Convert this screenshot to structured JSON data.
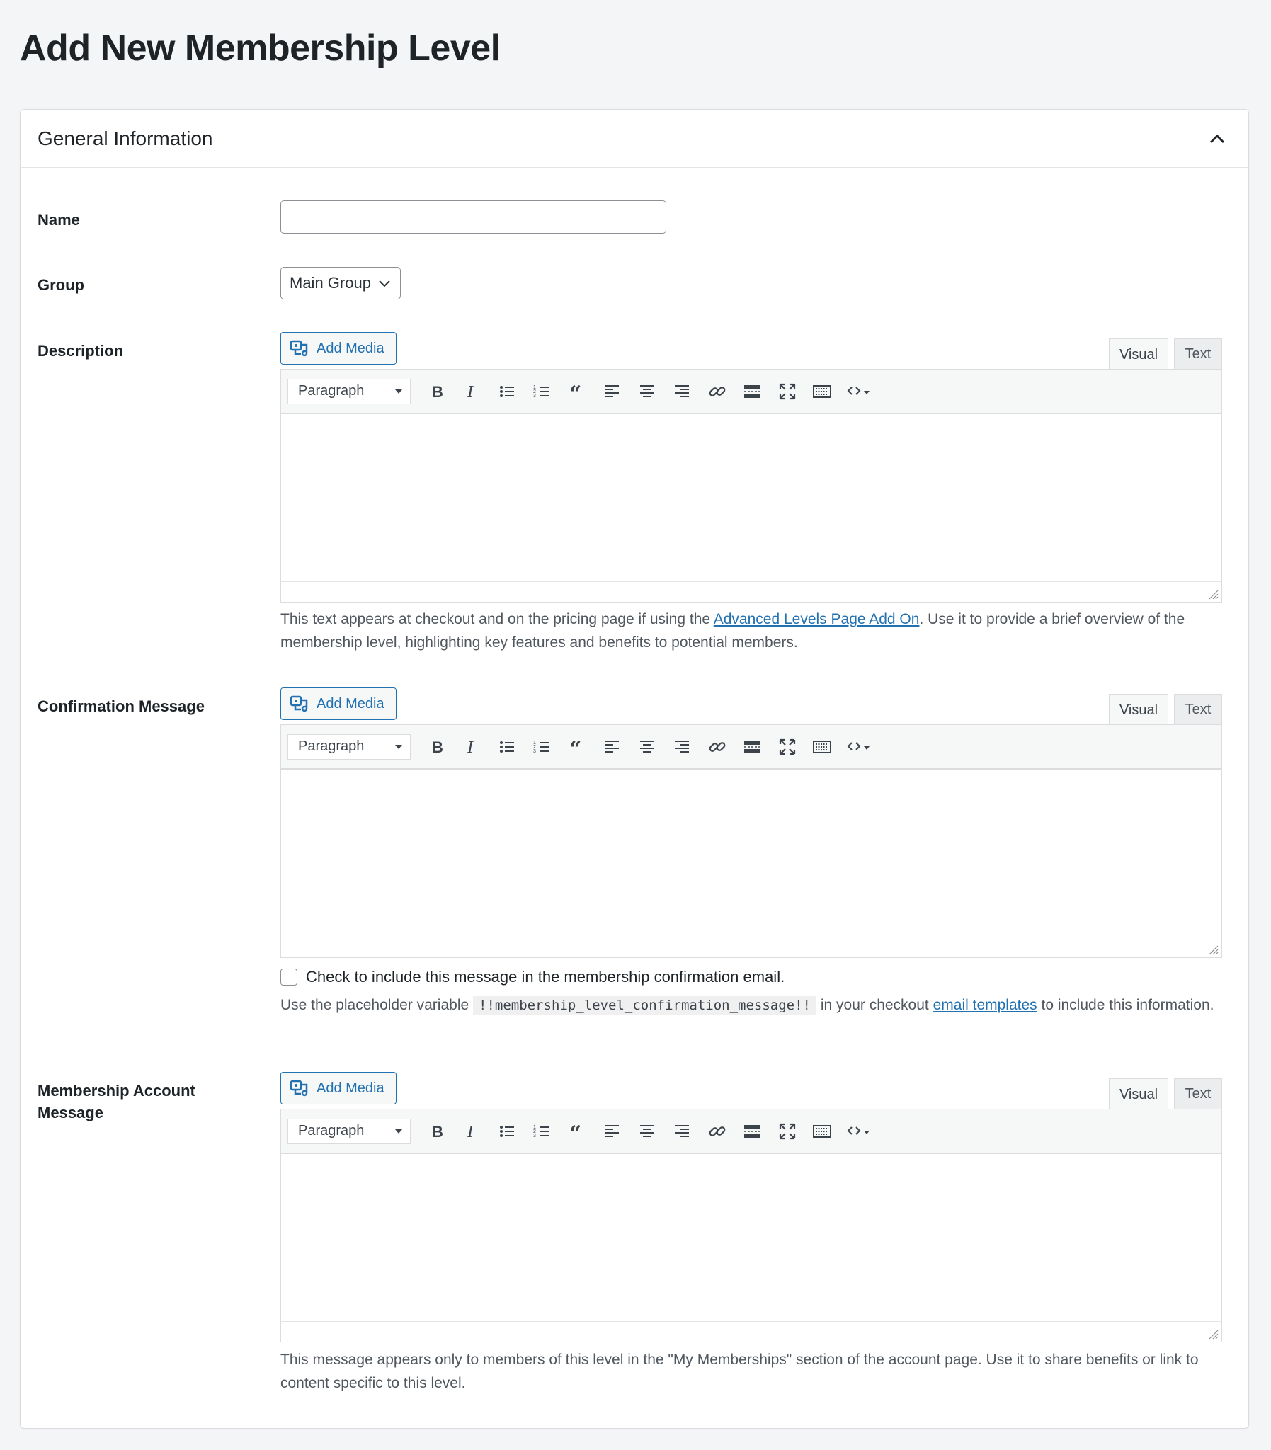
{
  "page": {
    "title": "Add New Membership Level"
  },
  "panel": {
    "title": "General Information"
  },
  "fields": {
    "name_label": "Name",
    "name_value": "",
    "group_label": "Group",
    "group_value": "Main Group",
    "description_label": "Description",
    "confirmation_label": "Confirmation Message",
    "account_label": "Membership Account Message"
  },
  "editor": {
    "add_media": "Add Media",
    "tab_visual": "Visual",
    "tab_text": "Text",
    "format": "Paragraph"
  },
  "description_help": {
    "before": "This text appears at checkout and on the pricing page if using the ",
    "link": "Advanced Levels Page Add On",
    "after": ". Use it to provide a brief overview of the membership level, highlighting key features and benefits to potential members."
  },
  "confirmation_help": {
    "checkbox_label": "Check to include this message in the membership confirmation email.",
    "before": "Use the placeholder variable ",
    "code": "!!membership_level_confirmation_message!!",
    "middle": " in your checkout ",
    "link": "email templates",
    "after": " to include this information."
  },
  "account_help": {
    "text": "This message appears only to members of this level in the \"My Memberships\" section of the account page. Use it to share benefits or link to content specific to this level."
  },
  "colors": {
    "accent": "#2271b1",
    "background": "#f3f5f7",
    "border": "#dcdcde"
  }
}
